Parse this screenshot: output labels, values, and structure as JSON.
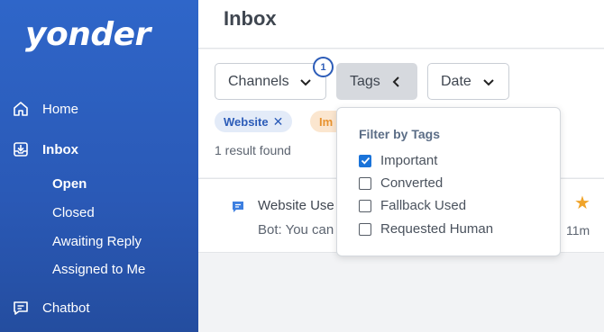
{
  "sidebar": {
    "logo": "yonder",
    "nav": [
      {
        "label": "Home",
        "icon": "home-icon"
      },
      {
        "label": "Inbox",
        "icon": "inbox-icon"
      },
      {
        "label": "Chatbot",
        "icon": "chatbot-icon"
      }
    ],
    "inbox_sub": [
      "Open",
      "Closed",
      "Awaiting Reply",
      "Assigned to Me"
    ],
    "active_sub": "Open"
  },
  "header": {
    "title": "Inbox"
  },
  "filters": {
    "channels_label": "Channels",
    "channels_count": "1",
    "tags_label": "Tags",
    "date_label": "Date"
  },
  "chips": {
    "website": "Website",
    "important_partial": "Im"
  },
  "result_text": "1 result found",
  "conversation": {
    "title": "Website Use",
    "preview": "Bot: You can",
    "time": "11m"
  },
  "tag_filter": {
    "title": "Filter by Tags",
    "options": [
      {
        "label": "Important",
        "checked": true
      },
      {
        "label": "Converted",
        "checked": false
      },
      {
        "label": "Fallback Used",
        "checked": false
      },
      {
        "label": "Requested Human",
        "checked": false
      }
    ]
  },
  "colors": {
    "sidebar": "#2a59b6",
    "accent": "#2c5cb8",
    "star": "#f0a42a",
    "checkbox": "#1a73d9"
  }
}
